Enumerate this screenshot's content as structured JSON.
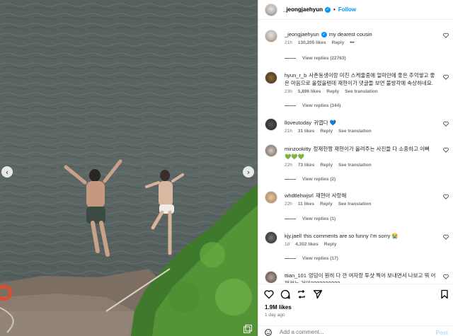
{
  "post_header": {
    "username": "_jeongjaehyun",
    "separator": "•",
    "follow_label": "Follow"
  },
  "comments": [
    {
      "username": "_jeongjaehyun",
      "text": "my dearest cousin",
      "time": "21h",
      "likes": "130,205 likes",
      "reply": "Reply",
      "more": "•••",
      "view_replies": "View replies (22763)",
      "verified": true
    },
    {
      "username": "hyun_r_b",
      "text": "사촌동생이랑 미친 스케줄중에 얼마만에 좋은 추억쌓고 좋은 마음으로 올렸을텐데 재현이가 댓글들 보면 불쌍각에 속상하네요.",
      "time": "23h",
      "likes": "5,896 likes",
      "reply": "Reply",
      "see_translation": "See translation",
      "view_replies": "View replies (344)"
    },
    {
      "username": "lloveutoday",
      "text": "귀엽다 💙",
      "time": "21h",
      "likes": "31 likes",
      "reply": "Reply",
      "see_translation": "See translation"
    },
    {
      "username": "minzookitty",
      "text": "정재현짱 재현이가 올려주는 사진들 다 소중하고 이뻐 💚💚💚",
      "time": "22h",
      "likes": "73 likes",
      "reply": "Reply",
      "see_translation": "See translation",
      "view_replies": "View replies (2)"
    },
    {
      "username": "whdtlehwjsrl",
      "text": "재현아 사랑해",
      "time": "22h",
      "likes": "11 likes",
      "reply": "Reply",
      "see_translation": "See translation",
      "view_replies": "View replies (1)"
    },
    {
      "username": "kjy.jaell",
      "text": "this comments are so funny I'm sorry 😭",
      "time": "1d",
      "likes": "4,302 likes",
      "reply": "Reply",
      "view_replies": "View replies (17)"
    },
    {
      "username": "ttian_101",
      "text": "엉덩이 뭔히 다 깐 여자랑 투샷 찍어 보내면서 나보고 뭐 어쩌라는 거야??????????",
      "time": "",
      "likes": ""
    }
  ],
  "footer": {
    "likes": "1.9M likes",
    "date": "1 day ago",
    "add_comment_placeholder": "Add a comment...",
    "post_label": "Post"
  },
  "colors": {
    "accent": "#0095f6",
    "muted": "#737373",
    "water": "#4a5558"
  },
  "icons": {
    "heart": "heart-icon",
    "comment": "comment-icon",
    "share": "share-icon",
    "repost": "repost-icon",
    "save": "bookmark-icon",
    "emoji": "emoji-icon",
    "prev": "chevron-left-icon",
    "next": "chevron-right-icon"
  }
}
